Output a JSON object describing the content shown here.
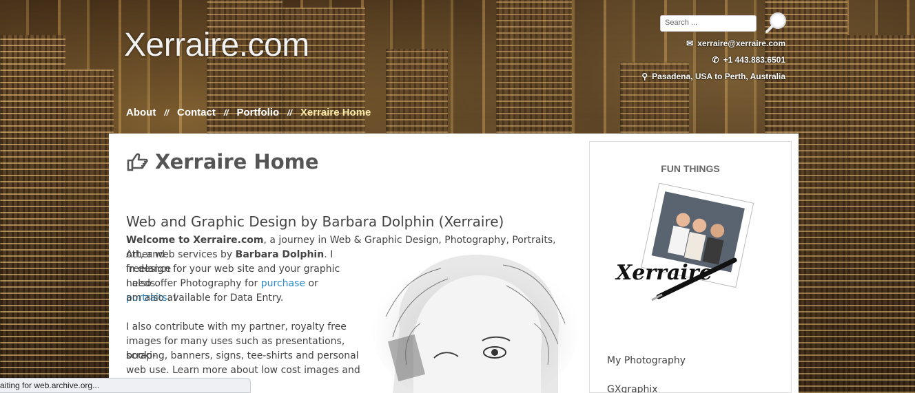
{
  "header": {
    "site_title": "Xerraire.com",
    "search_placeholder": "Search ...",
    "email": "xerraire@xerraire.com",
    "phone": "+1 443.883.6501",
    "location": "Pasadena, USA to Perth, Australia"
  },
  "nav": {
    "items": [
      {
        "label": "About"
      },
      {
        "label": "Contact"
      },
      {
        "label": "Portfolio"
      },
      {
        "label": "Xerraire Home"
      }
    ],
    "separator": "//"
  },
  "main": {
    "page_title": "Xerraire Home",
    "subheading": "Web and Graphic Design by Barbara Dolphin (Xerraire)",
    "intro": {
      "welcome_bold": "Welcome to Xerraire.com",
      "text_1": ", a journey in Web & Graphic Design, Photography, Portraits, Art, and",
      "text_2": "other web services by ",
      "name_bold": "Barbara Dolphin",
      "text_3": ". I freelance",
      "text_4": "in design for your web site and your graphic needs.",
      "text_5": "I also offer Photography for ",
      "link_purchase": "purchase",
      "text_or": " or ",
      "link_portraits": "portraits",
      "text_6": ". I",
      "text_7": "am also available for Data Entry."
    },
    "para2": {
      "line_1": "I also contribute with my partner, royalty free",
      "line_2": "images for many uses such as presentations, scrap-",
      "line_3": "booking, banners, signs, tee-shirts and personal",
      "line_4": "web use. Learn more about low cost images and"
    }
  },
  "sidebar": {
    "title": "FUN THINGS",
    "logo_signature": "Xerraire",
    "links": [
      "My Photography",
      "GXgraphix"
    ]
  },
  "statusbar": {
    "text": "aiting for web.archive.org..."
  },
  "colors": {
    "link": "#2a8acb",
    "nav_current": "#f7e9a8",
    "heading": "#555555"
  }
}
